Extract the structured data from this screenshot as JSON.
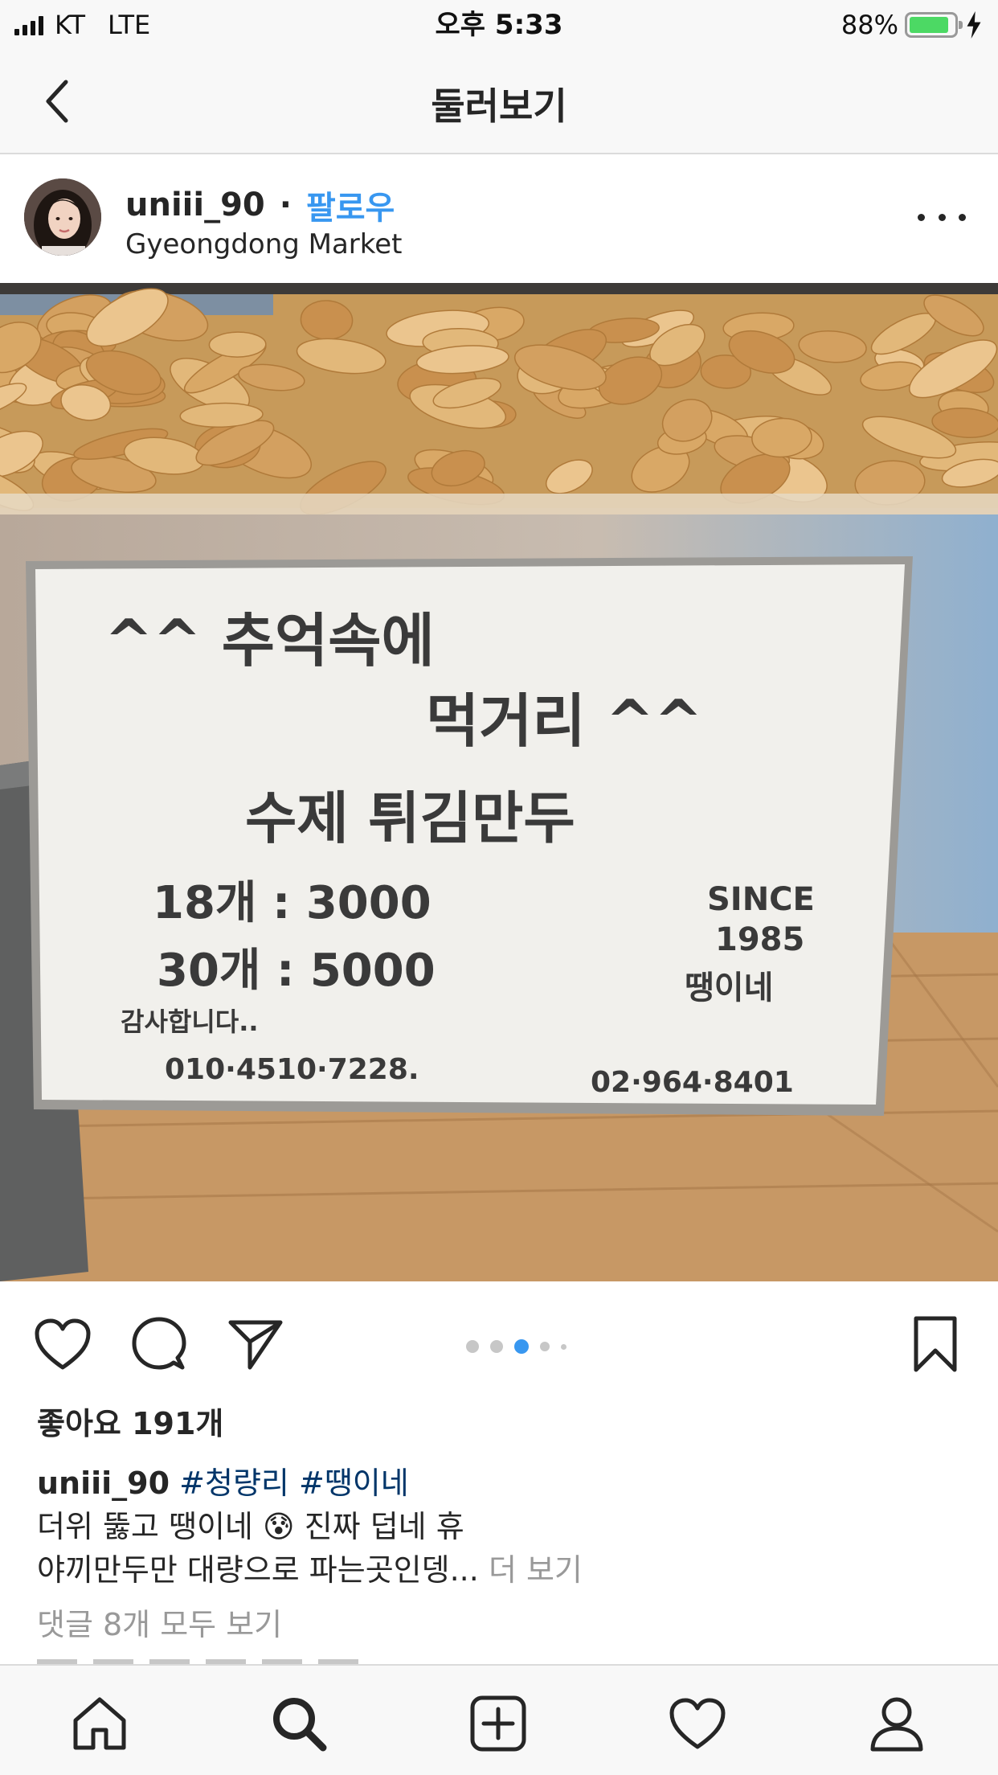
{
  "status_bar": {
    "carrier": "KT",
    "network": "LTE",
    "time": "오후 5:33",
    "battery_percent": "88%",
    "battery_level": 0.88
  },
  "nav": {
    "title": "둘러보기",
    "back_icon": "chevron-left-icon"
  },
  "post": {
    "username": "uniii_90",
    "separator": "·",
    "follow_label": "팔로우",
    "location": "Gyeongdong Market",
    "more_icon": "ellipsis-icon"
  },
  "photo": {
    "sign_lines": [
      "^^ 추억속에",
      "먹거리 ^^",
      "수제 튀김만두",
      "18개 : 3000",
      "30개 : 5000",
      "SINCE",
      "1985",
      "땡이네",
      "감사합니다..",
      "010·4510·7228.",
      "02·964·8401"
    ]
  },
  "actions": {
    "like_icon": "heart-icon",
    "comment_icon": "comment-bubble-icon",
    "share_icon": "paper-plane-icon",
    "save_icon": "bookmark-icon",
    "carousel_active_index": 3,
    "carousel_total": 5
  },
  "likes_text": "좋아요 191개",
  "caption": {
    "username": "uniii_90",
    "hashtag1": "#청량리",
    "hashtag2": "#땡이네",
    "line2_a": "더위 뚫고 땡이네",
    "emoji": "😰",
    "line2_b": "진짜 덥네 휴",
    "line3": "야끼만두만 대량으로 파는곳인뎅...",
    "more": "더 보기"
  },
  "comments_link": "댓글 8개 모두 보기",
  "tab_bar": {
    "items": [
      "home-icon",
      "search-icon",
      "add-post-icon",
      "activity-heart-icon",
      "profile-icon"
    ],
    "active": "search-icon"
  },
  "colors": {
    "link_blue": "#3897f0",
    "hashtag_blue": "#003569",
    "active_dot": "#3897f0",
    "battery_green": "#4cd964",
    "muted_gray": "#999999"
  }
}
